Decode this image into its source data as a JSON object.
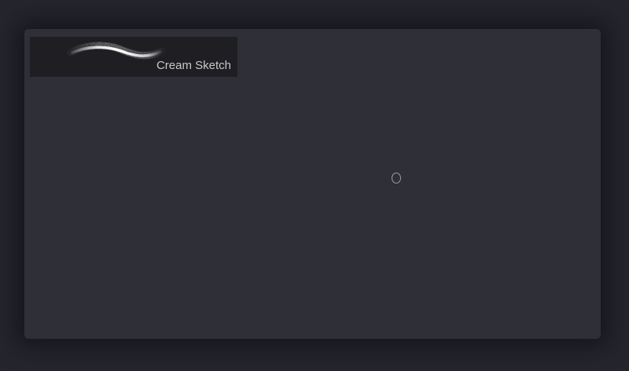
{
  "brush_library": {
    "items": [
      {
        "name": "Cream Sketch",
        "preview_icon": "brush-stroke-preview-icon",
        "selected": true
      }
    ]
  },
  "canvas": {
    "cursor_icon": "brush-cursor-icon"
  },
  "colors": {
    "background": "#25252d",
    "panel": "#2e2f37",
    "tile": "#1f1e22",
    "label": "#c8c8cc"
  }
}
